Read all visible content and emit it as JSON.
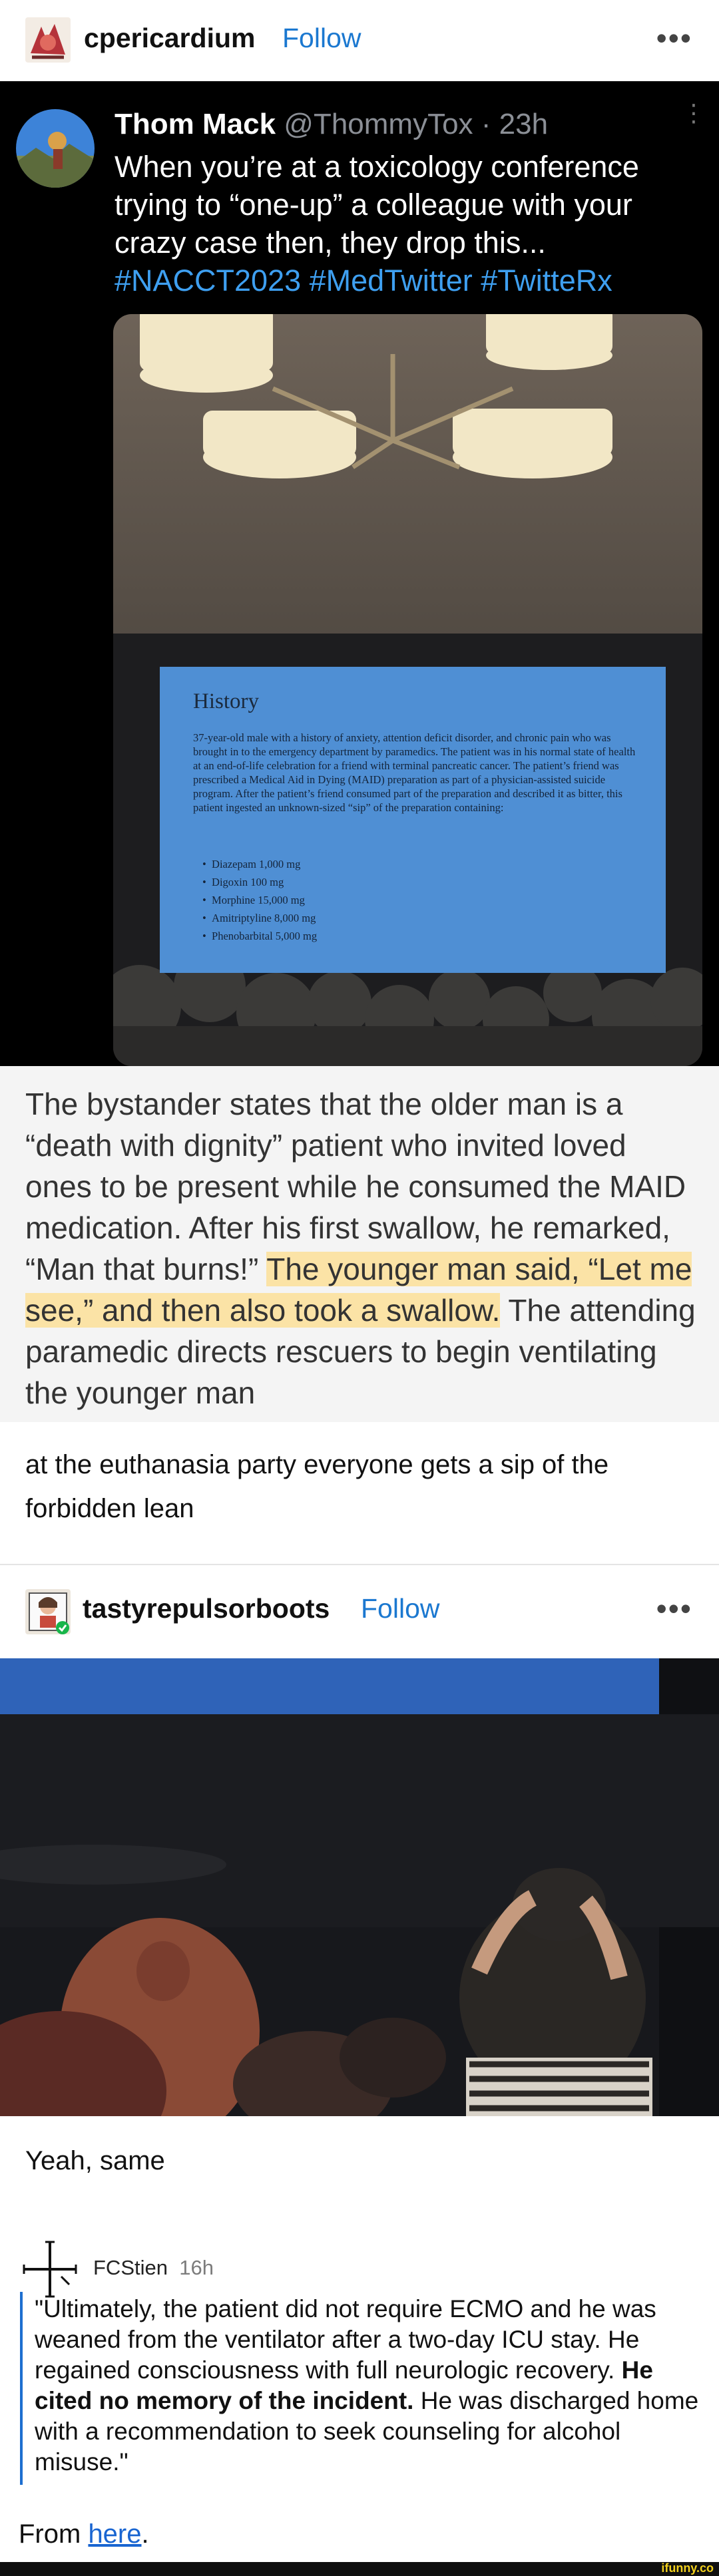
{
  "post1": {
    "username": "cpericardium",
    "follow_label": "Follow",
    "more_label": "•••"
  },
  "tweet": {
    "author_name": "Thom Mack",
    "author_handle": "@ThommyTox",
    "time": "· 23h",
    "text": "When you’re at a toxicology conference trying to “one-up” a colleague with your crazy case then, they drop this...",
    "hashtags": "#NACCT2023 #MedTwitter #TwitteRx"
  },
  "slide": {
    "title": "History",
    "body": "37-year-old male with a history of anxiety, attention deficit disorder, and chronic pain who was brought in to the emergency department by paramedics. The patient was in his normal state of health at an end-of-life celebration for a friend with terminal pancreatic cancer. The patient’s friend was prescribed a Medical Aid in Dying (MAID) preparation as part of a physician-assisted suicide program. After the patient’s friend consumed part of the preparation and described it as bitter, this patient ingested an unknown-sized “sip” of the preparation containing:",
    "items": [
      "Diazepam 1,000 mg",
      "Digoxin 100 mg",
      "Morphine 15,000 mg",
      "Amitriptyline 8,000 mg",
      "Phenobarbital 5,000 mg"
    ]
  },
  "excerpt": {
    "part1": "The bystander states that the older man is a “death with dignity” patient who invited loved ones to be present while he consumed the MAID medication. After his first swallow, he remarked, “Man that burns!” ",
    "highlight": "The younger man said, “Let me see,” and then also took a swallow.",
    "part2": " The attending paramedic directs rescuers to begin ventilating the younger man"
  },
  "comment1": "at the euthanasia party everyone gets a sip of the forbidden lean",
  "post2": {
    "username": "tastyrepulsorboots",
    "follow_label": "Follow",
    "more_label": "•••"
  },
  "comment2": "Yeah, same",
  "reply": {
    "username": "FCStien",
    "time": "16h",
    "quote_part1": "\"Ultimately, the patient did not require ECMO and he was weaned from the ventilator after a two-day ICU stay. He regained consciousness with full neurologic recovery. ",
    "quote_bold": "He cited no memory of the incident.",
    "quote_part2": " He was discharged home with a recommendation to seek counseling for alcohol misuse.\""
  },
  "from": {
    "prefix": "From ",
    "link": "here",
    "suffix": "."
  },
  "watermark": "ifunny.co",
  "colors": {
    "follow": "#1b78d0",
    "hashtag": "#3e9ff0",
    "highlight": "#fbe3a6",
    "link": "#1965d1",
    "quote_bar": "#1e6fd0",
    "watermark": "#f2d01c"
  }
}
